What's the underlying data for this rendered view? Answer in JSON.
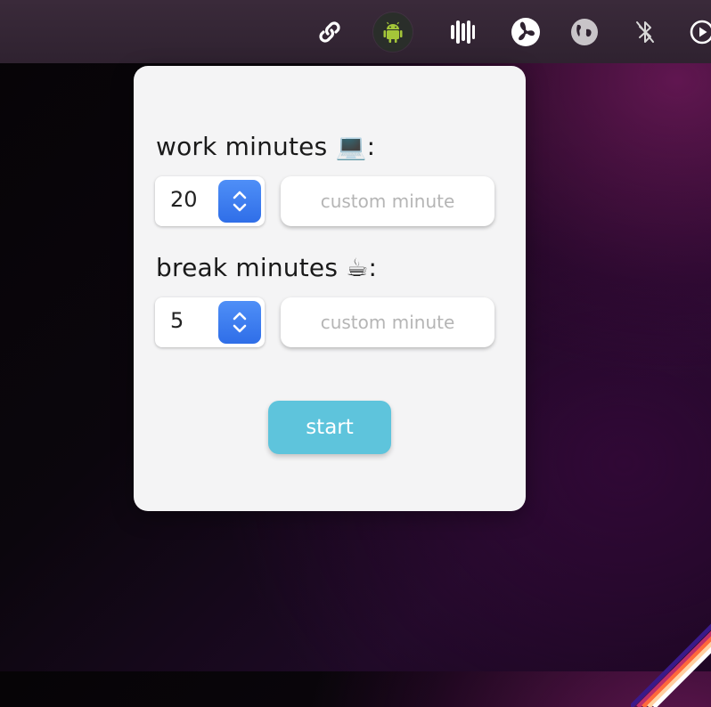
{
  "menubar": {
    "icons": [
      "link-icon",
      "android-icon",
      "bars-icon",
      "fan-icon",
      "globe-icon",
      "bluetooth-off-icon",
      "play-icon"
    ],
    "active_icon": "android-icon",
    "android_color": "#a4c639"
  },
  "panel": {
    "work_label": "work minutes",
    "work_emoji": "💻",
    "work_colon": ":",
    "work_value": "20",
    "work_custom_placeholder": "custom minute",
    "break_label": "break minutes",
    "break_emoji": "☕",
    "break_colon": ":",
    "break_value": "5",
    "break_custom_placeholder": "custom minute",
    "start_label": "start"
  },
  "colors": {
    "start_button": "#5ec4dc",
    "stepper_blue": "#3b7bf0",
    "panel_bg": "#f4f4f5"
  }
}
